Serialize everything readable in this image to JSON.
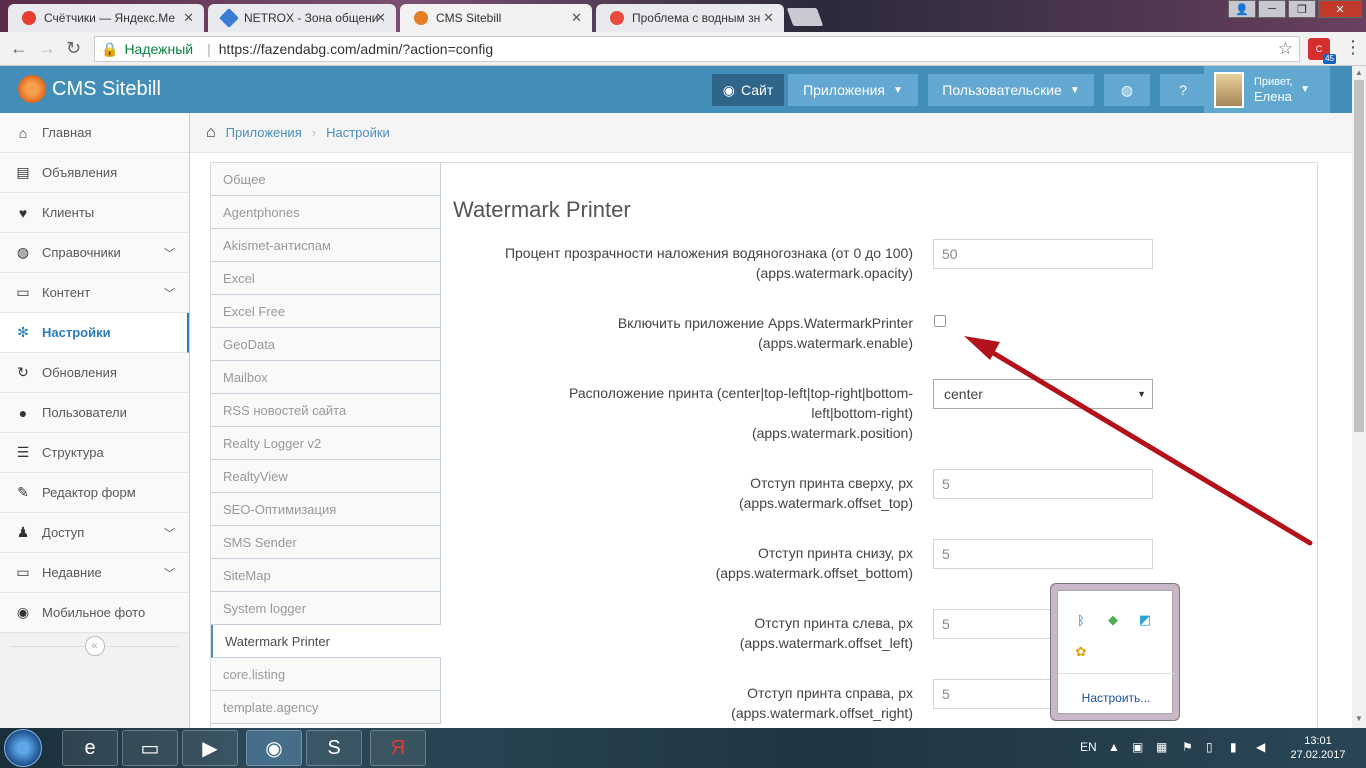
{
  "browser": {
    "tabs": [
      {
        "label": "Счётчики — Яндекс.Ме",
        "icon": "yandex-metrica-icon",
        "color": "#e63d2e"
      },
      {
        "label": "NETROX - Зона общени",
        "icon": "netrox-icon",
        "color": "#3a7bd5"
      },
      {
        "label": "CMS Sitebill",
        "icon": "sitebill-icon",
        "color": "#e67e22"
      },
      {
        "label": "Проблема с водным зн",
        "icon": "sitebill-icon",
        "color": "#e74c3c"
      }
    ],
    "secure_label": "Надежный",
    "url": "https://fazendabg.com/admin/?action=config",
    "extension_badge": "45"
  },
  "navbar": {
    "brand": "CMS Sitebill",
    "site_button": "Сайт",
    "apps_button": "Приложения",
    "custom_button": "Пользовательские",
    "user_greeting": "Привет,",
    "user_name": "Елена"
  },
  "sidebar": {
    "items": [
      {
        "label": "Главная",
        "icon": "home-icon",
        "glyph": "⌂"
      },
      {
        "label": "Объявления",
        "icon": "book-icon",
        "glyph": "▤"
      },
      {
        "label": "Клиенты",
        "icon": "heart-icon",
        "glyph": "♥"
      },
      {
        "label": "Справочники",
        "icon": "globe-icon",
        "glyph": "◍"
      },
      {
        "label": "Контент",
        "icon": "laptop-icon",
        "glyph": "▭"
      },
      {
        "label": "Настройки",
        "icon": "cog-icon",
        "glyph": "✻"
      },
      {
        "label": "Обновления",
        "icon": "refresh-icon",
        "glyph": "↻"
      },
      {
        "label": "Пользователи",
        "icon": "user-icon",
        "glyph": "●"
      },
      {
        "label": "Структура",
        "icon": "list-icon",
        "glyph": "☰"
      },
      {
        "label": "Редактор форм",
        "icon": "edit-icon",
        "glyph": "✎"
      },
      {
        "label": "Доступ",
        "icon": "users-icon",
        "glyph": "♟"
      },
      {
        "label": "Недавние",
        "icon": "desktop-icon",
        "glyph": "▭"
      },
      {
        "label": "Мобильное фото",
        "icon": "camera-icon",
        "glyph": "◉"
      }
    ]
  },
  "breadcrumb": {
    "items": [
      "Приложения",
      "Настройки"
    ]
  },
  "config_tabs": [
    "Общее",
    "Agentphones",
    "Akismet-антиспам",
    "Excel",
    "Excel Free",
    "GeoData",
    "Mailbox",
    "RSS новостей сайта",
    "Realty Logger v2",
    "RealtyView",
    "SEO-Оптимизация",
    "SMS Sender",
    "SiteMap",
    "System logger",
    "Watermark Printer",
    "core.listing",
    "template.agency"
  ],
  "form": {
    "title": "Watermark Printer",
    "fields": [
      {
        "label": "Процент прозрачности наложения водяногознака (от 0 до 100)",
        "key": "(apps.watermark.opacity)",
        "value": "50"
      },
      {
        "label": "Включить приложение Apps.WatermarkPrinter",
        "key": "(apps.watermark.enable)",
        "checked": false
      },
      {
        "label_line1": "Расположение принта (center|top-left|top-right|bottom-",
        "label_line2": "left|bottom-right)",
        "key": "(apps.watermark.position)",
        "value": "center"
      },
      {
        "label": "Отступ принта сверху, px",
        "key": "(apps.watermark.offset_top)",
        "value": "5"
      },
      {
        "label": "Отступ принта снизу, px",
        "key": "(apps.watermark.offset_bottom)",
        "value": "5"
      },
      {
        "label": "Отступ принта слева, px",
        "key": "(apps.watermark.offset_left)",
        "value": "5"
      },
      {
        "label": "Отступ принта справа, px",
        "key": "(apps.watermark.offset_right)",
        "value": "5"
      }
    ]
  },
  "tray_popup": {
    "link": "Настроить..."
  },
  "taskbar": {
    "lang": "EN",
    "time": "13:01",
    "date": "27.02.2017"
  }
}
